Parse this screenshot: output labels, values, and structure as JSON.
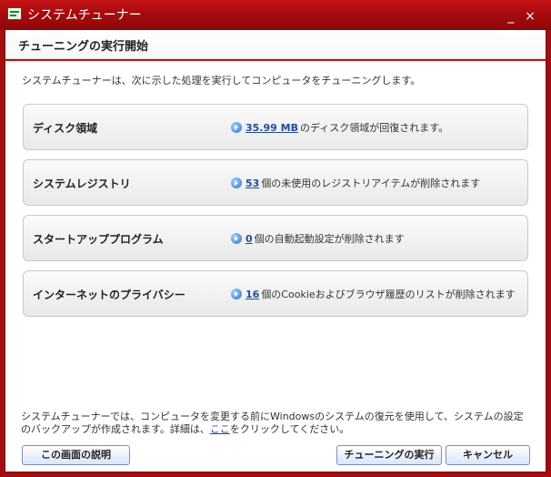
{
  "window": {
    "title": "システムチューナー",
    "minimize_symbol": "_",
    "close_symbol": "×"
  },
  "header": {
    "title": "チューニングの実行開始"
  },
  "intro_text": "システムチューナーは、次に示した処理を実行してコンピュータをチューニングします。",
  "items": [
    {
      "title": "ディスク領域",
      "count": "35.99 MB",
      "text": "のディスク領域が回復されます。"
    },
    {
      "title": "システムレジストリ",
      "count": "53",
      "text": "個の未使用のレジストリアイテムが削除されます"
    },
    {
      "title": "スタートアッププログラム",
      "count": "0",
      "text": "個の自動起動設定が削除されます"
    },
    {
      "title": "インターネットのプライバシー",
      "count": "16",
      "text": "個のCookieおよびブラウザ履歴のリストが削除されます"
    }
  ],
  "footer": {
    "line1": "システムチューナーでは、コンピュータを変更する前にWindowsのシステムの復元を使用して、システムの設定",
    "line2_before": "のバックアップが作成されます。詳細は、",
    "line2_link": "ここ",
    "line2_after": "をクリックしてください。"
  },
  "buttons": {
    "help": "この画面の説明",
    "start": "チューニングの実行",
    "cancel": "キャンセル"
  },
  "icons": {
    "app": "system-tuner-icon",
    "arrow": "arrow-right-circle-icon"
  },
  "colors": {
    "window_red": "#a10d10",
    "header_rule": "#bd1014",
    "link_blue": "#1f4d99"
  }
}
